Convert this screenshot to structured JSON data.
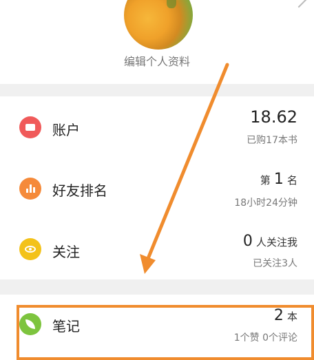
{
  "profile": {
    "edit_label": "编辑个人资料"
  },
  "rows": [
    {
      "name": "account",
      "label": "账户",
      "main_value": "18.62",
      "unit": "",
      "sub": "已购17本书",
      "color": "#f05a5a",
      "icon": "wallet-icon"
    },
    {
      "name": "friend-ranking",
      "label": "好友排名",
      "prefix": "第",
      "main_value": "1",
      "unit": "名",
      "sub": "18小时24分钟",
      "color": "#f58a3a",
      "icon": "bar-chart-icon"
    },
    {
      "name": "follow",
      "label": "关注",
      "main_value": "0",
      "unit": "人关注我",
      "sub": "已关注3人",
      "color": "#f3c21a",
      "icon": "eye-icon"
    },
    {
      "name": "notes",
      "label": "笔记",
      "main_value": "2",
      "unit": "本",
      "sub": "1个赞 0个评论",
      "color": "#7dc43e",
      "icon": "leaf-icon"
    }
  ],
  "colors": {
    "annotation": "#f08c2e",
    "divider": "#f0f0f0"
  }
}
